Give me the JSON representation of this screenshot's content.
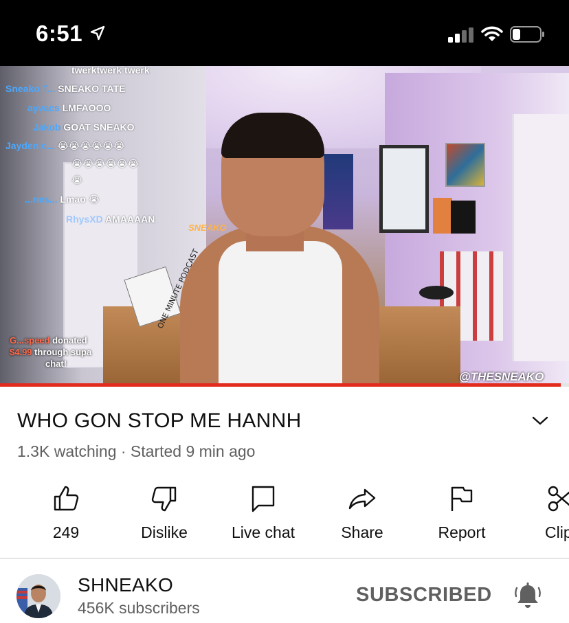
{
  "status_bar": {
    "time": "6:51",
    "icons": [
      "location-arrow-icon",
      "cellular-signal-icon",
      "wifi-icon",
      "battery-icon"
    ]
  },
  "video": {
    "chat": [
      {
        "name": "",
        "message": "twerktwerk twerk"
      },
      {
        "name": "Sneako T...",
        "message": "SNEAKO TATE"
      },
      {
        "name": "ayvacs",
        "message": "LMFAOOO"
      },
      {
        "name": "Jakob",
        "message": "GOAT SNEAKO"
      },
      {
        "name": "Jayden c...",
        "message": "😭😭😭😭😭😭"
      },
      {
        "name": "",
        "message": "😭😭😭😭😭😭"
      },
      {
        "name": "",
        "message": "😭"
      },
      {
        "name": "...nes...",
        "message": "Lmao 😭"
      },
      {
        "name": "RhysXD",
        "message": "AMAAAAN"
      }
    ],
    "donation": {
      "name": "G...speed",
      "text_1": "donated",
      "amount": "$4.99",
      "text_2": "through supa",
      "text_3": "chat!"
    },
    "sign_text": "ONE MINUTE PODCAST",
    "neon_text": "SNEAKO",
    "watermark": "@THESNEAKO",
    "progress": 0.985,
    "progress_color": "#e32b1d"
  },
  "title": "WHO GON STOP ME HANNH",
  "meta": "1.3K watching · Started 9 min ago",
  "actions": [
    {
      "key": "like",
      "icon": "thumbs-up-icon",
      "label": "249"
    },
    {
      "key": "dislike",
      "icon": "thumbs-down-icon",
      "label": "Dislike"
    },
    {
      "key": "live-chat",
      "icon": "chat-bubble-icon",
      "label": "Live chat"
    },
    {
      "key": "share",
      "icon": "share-arrow-icon",
      "label": "Share"
    },
    {
      "key": "report",
      "icon": "flag-icon",
      "label": "Report"
    },
    {
      "key": "clip",
      "icon": "scissors-icon",
      "label": "Clip"
    }
  ],
  "channel": {
    "name": "SHNEAKO",
    "subscribers": "456K subscribers",
    "subscribe_label": "SUBSCRIBED",
    "bell_icon": "bell-ringing-icon"
  }
}
